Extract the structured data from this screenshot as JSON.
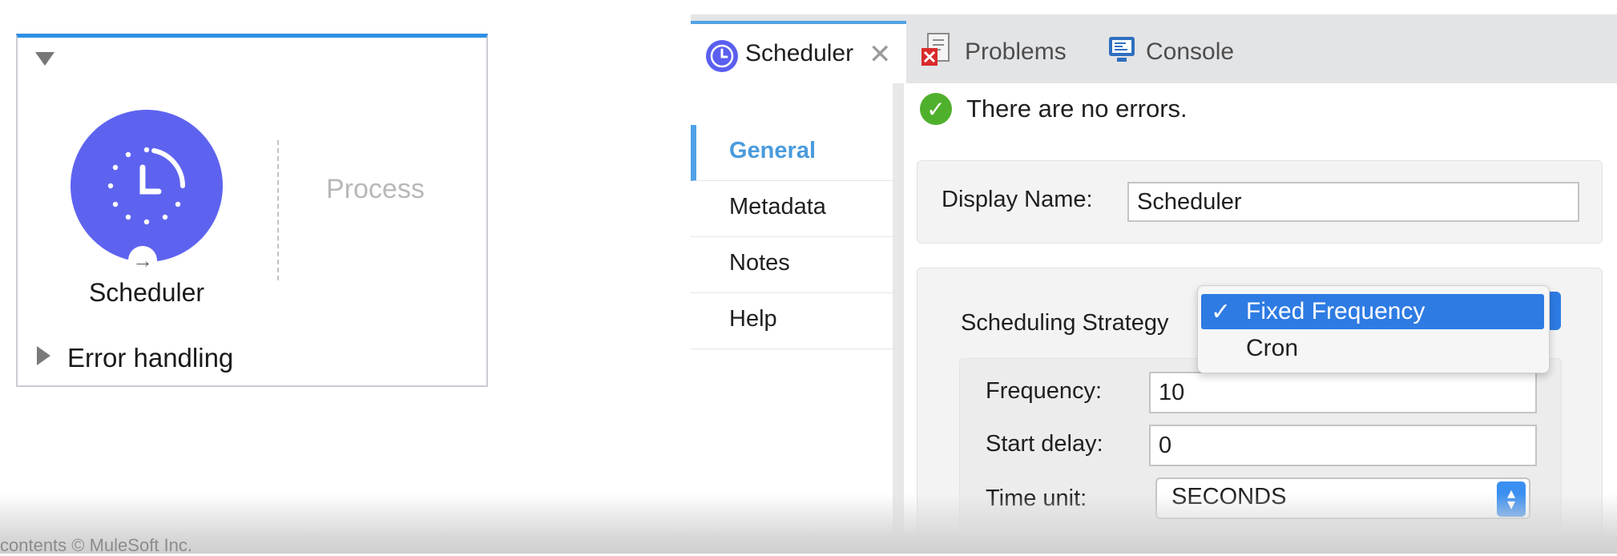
{
  "flow": {
    "component_label": "Scheduler",
    "process_label": "Process",
    "error_handling_label": "Error handling",
    "accent_color": "#5e63ef"
  },
  "tabs": [
    {
      "label": "Scheduler",
      "icon": "clock-icon",
      "active": true
    },
    {
      "label": "Problems",
      "icon": "problems-icon",
      "active": false
    },
    {
      "label": "Console",
      "icon": "console-icon",
      "active": false
    }
  ],
  "nav": {
    "items": [
      "General",
      "Metadata",
      "Notes",
      "Help"
    ],
    "active": "General"
  },
  "status": {
    "text": "There are no errors.",
    "icon": "check-circle-icon",
    "color": "#4fb02c"
  },
  "form": {
    "display_name_label": "Display Name:",
    "display_name_value": "Scheduler",
    "strategy_label": "Scheduling Strategy",
    "strategy_options": [
      "Fixed Frequency",
      "Cron"
    ],
    "strategy_selected": "Fixed Frequency",
    "check_mark": "✓",
    "frequency_label": "Frequency:",
    "frequency_value": "10",
    "start_delay_label": "Start delay:",
    "start_delay_value": "0",
    "time_unit_label": "Time unit:",
    "time_unit_value": "SECONDS"
  },
  "caption": "contents © MuleSoft Inc."
}
